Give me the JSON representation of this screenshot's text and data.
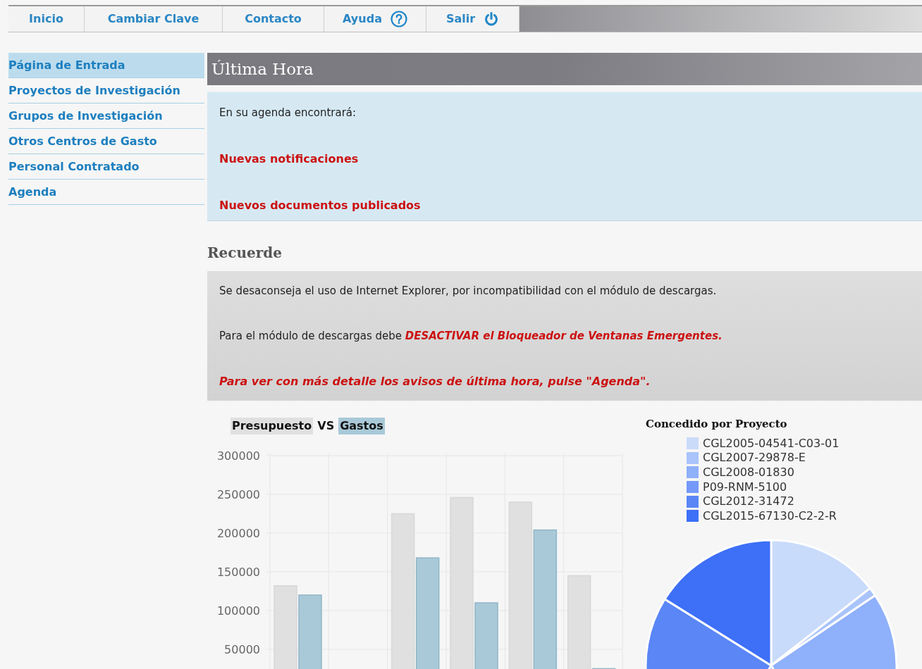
{
  "nav": [
    {
      "label": "Inicio"
    },
    {
      "label": "Cambiar Clave"
    },
    {
      "label": "Contacto"
    },
    {
      "label": "Ayuda",
      "kind": "help"
    },
    {
      "label": "Salir",
      "kind": "power"
    }
  ],
  "sidebar": {
    "items": [
      {
        "label": "Página de Entrada",
        "selected": true
      },
      {
        "label": "Proyectos de Investigación",
        "selected": false
      },
      {
        "label": "Grupos de Investigación",
        "selected": false
      },
      {
        "label": "Otros Centros de Gasto",
        "selected": false
      },
      {
        "label": "Personal Contratado",
        "selected": false
      },
      {
        "label": "Agenda",
        "selected": false
      }
    ]
  },
  "news": {
    "title": "Última Hora",
    "intro": "En su agenda encontrará:",
    "links": [
      "Nuevas notificaciones",
      "Nuevos documentos publicados"
    ]
  },
  "reminder": {
    "title": "Recuerde",
    "notes": [
      {
        "kind": "plain",
        "text": "Se desaconseja el uso de Internet Explorer, por incompatibilidad con el módulo de descargas."
      },
      {
        "kind": "mixed",
        "text": "Para el módulo de descargas debe",
        "highlight": "DESACTIVAR el Bloqueador de Ventanas Emergentes."
      },
      {
        "kind": "alert",
        "text": "Para ver con más detalle los avisos de última hora, pulse \"Agenda\"."
      }
    ]
  },
  "budget_chart": {
    "legend_separator": "VS",
    "chart_data": {
      "type": "bar",
      "series": [
        {
          "name": "Presupuesto",
          "color": "#e0e0e0",
          "values": [
            132000,
            null,
            225000,
            246000,
            240000,
            145000
          ]
        },
        {
          "name": "Gastos",
          "color": "#a9c9d8",
          "values": [
            120000,
            null,
            168000,
            110000,
            204000,
            25000
          ]
        }
      ],
      "grid": true,
      "ylim": [
        0,
        300000
      ],
      "yticks": [
        50000,
        100000,
        150000,
        200000,
        250000,
        300000
      ]
    }
  },
  "project_chart": {
    "title": "Concedido por Proyecto",
    "legend": [
      {
        "label": "CGL2005-04541-C03-01",
        "color": "#c9dbfa"
      },
      {
        "label": "CGL2007-29878-E",
        "color": "#a9c4fb"
      },
      {
        "label": "CGL2008-01830",
        "color": "#8fb0fa"
      },
      {
        "label": "P09-RNM-5100",
        "color": "#7499f8"
      },
      {
        "label": "CGL2012-31472",
        "color": "#5a86f6"
      },
      {
        "label": "CGL2015-67130-C2-2-R",
        "color": "#3d6ff7"
      }
    ]
  }
}
